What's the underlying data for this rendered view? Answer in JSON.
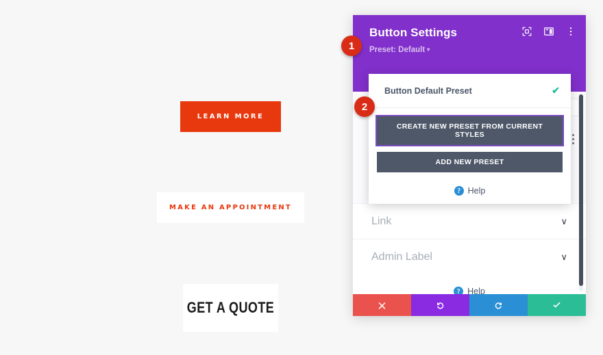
{
  "page_preview": {
    "buttons": [
      {
        "name": "learn-more",
        "label": "LEARN MORE",
        "style": "solid-orange"
      },
      {
        "name": "make-appointment",
        "label": "MAKE AN APPOINTMENT",
        "style": "white-orange-text"
      },
      {
        "name": "get-a-quote",
        "label": "GET A QUOTE",
        "style": "white-black-text"
      }
    ]
  },
  "modal": {
    "title": "Button Settings",
    "preset_line": "Preset: Default",
    "preset_caret": "▾",
    "header_icons": [
      {
        "name": "focus-icon"
      },
      {
        "name": "layout-columns-icon"
      },
      {
        "name": "more-vertical-icon"
      }
    ],
    "preset_dropdown": {
      "current_preset_label": "Button Default Preset",
      "check_glyph": "✔",
      "create_preset_button": "CREATE NEW PRESET FROM CURRENT STYLES",
      "add_preset_button": "ADD NEW PRESET",
      "help_label": "Help",
      "help_glyph": "?"
    },
    "sections": [
      {
        "name": "link",
        "label": "Link",
        "chevron": "∨"
      },
      {
        "name": "admin-label",
        "label": "Admin Label",
        "chevron": "∨"
      }
    ],
    "bottom_help": {
      "label": "Help",
      "glyph": "?"
    },
    "footer_buttons": [
      {
        "name": "cancel",
        "icon": "close-icon",
        "color": "#e9524d"
      },
      {
        "name": "undo",
        "icon": "undo-icon",
        "color": "#8a2be2"
      },
      {
        "name": "redo",
        "icon": "redo-icon",
        "color": "#2a8fd4"
      },
      {
        "name": "save",
        "icon": "check-icon",
        "color": "#2bbd96"
      }
    ]
  },
  "callouts": [
    {
      "name": "callout-1",
      "number": "1"
    },
    {
      "name": "callout-2",
      "number": "2"
    }
  ],
  "colors": {
    "header_purple": "#8130cb",
    "accent_orange": "#e8380d",
    "dark_button": "#4e5869",
    "badge_red": "#d82c16",
    "background": "#f7f7f7"
  }
}
